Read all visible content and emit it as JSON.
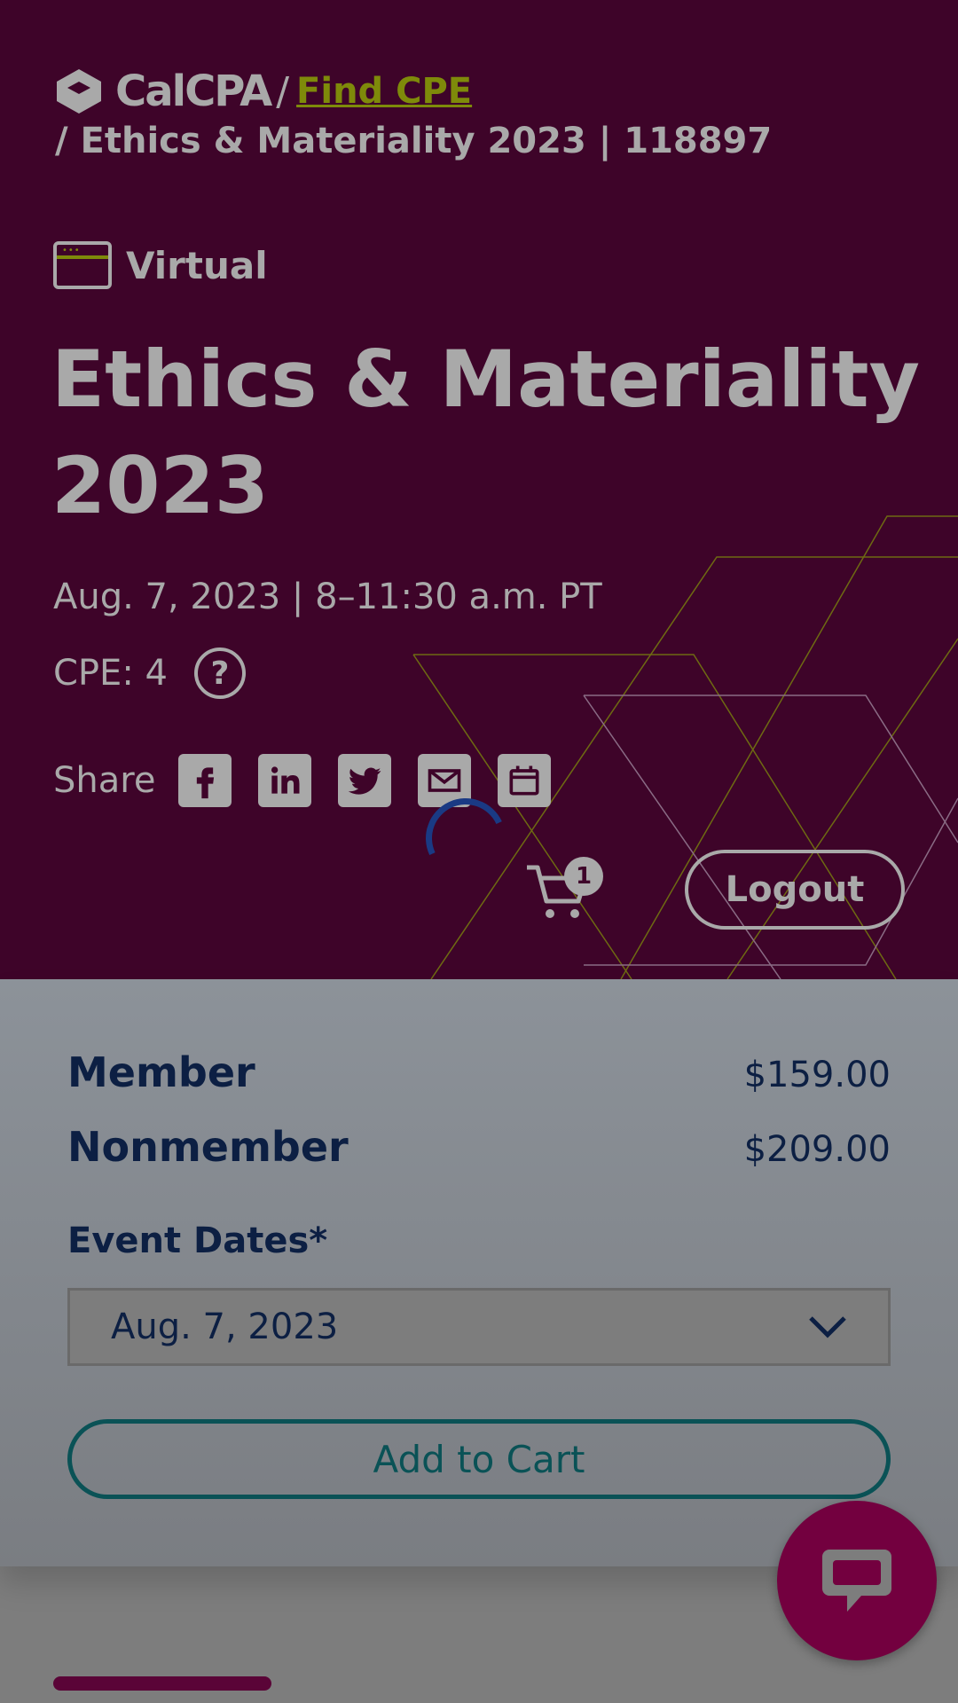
{
  "breadcrumb": {
    "logo_text": "CalCPA",
    "separator": "/",
    "link": "Find CPE",
    "current": "/ Ethics & Materiality 2023 | 118897"
  },
  "event": {
    "format": "Virtual",
    "title": "Ethics & Materiality 2023",
    "when": "Aug. 7, 2023 | 8–11:30 a.m. PT",
    "cpe": "CPE: 4",
    "help_icon": "?"
  },
  "share": {
    "label": "Share",
    "icons": [
      "facebook-icon",
      "linkedin-icon",
      "twitter-icon",
      "email-icon",
      "calendar-icon"
    ]
  },
  "cart": {
    "count": "1"
  },
  "logout_label": "Logout",
  "pricing": {
    "member_label": "Member",
    "member_price": "$159.00",
    "nonmember_label": "Nonmember",
    "nonmember_price": "$209.00"
  },
  "event_dates": {
    "label": "Event Dates*",
    "selected": "Aug. 7, 2023"
  },
  "add_to_cart_label": "Add to Cart",
  "colors": {
    "hero_bg": "#3e0429",
    "accent_olive": "#7e8a0a",
    "navy_text": "#0c1f43",
    "teal": "#0a5256",
    "chat_bg": "#73003f"
  }
}
